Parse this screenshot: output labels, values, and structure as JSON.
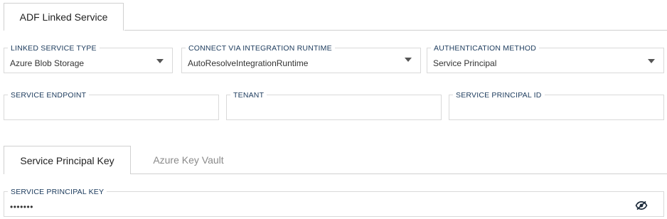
{
  "top_tabs": {
    "active_label": "ADF Linked Service"
  },
  "fields": {
    "linked_service_type": {
      "label": "LINKED SERVICE TYPE",
      "value": "Azure Blob Storage"
    },
    "integration_runtime": {
      "label": "CONNECT VIA INTEGRATION RUNTIME",
      "value": "AutoResolveIntegrationRuntime"
    },
    "authentication_method": {
      "label": "AUTHENTICATION METHOD",
      "value": "Service Principal"
    },
    "service_endpoint": {
      "label": "SERVICE ENDPOINT",
      "value": ""
    },
    "tenant": {
      "label": "TENANT",
      "value": ""
    },
    "service_principal_id": {
      "label": "SERVICE PRINCIPAL ID",
      "value": ""
    },
    "service_principal_key": {
      "label": "SERVICE PRINCIPAL KEY",
      "value": "•••••••"
    }
  },
  "key_tabs": {
    "active_label": "Service Principal Key",
    "inactive_label": "Azure Key Vault"
  },
  "icons": {
    "dropdown": "chevron-down-icon",
    "visibility": "eye-slash-icon"
  },
  "colors": {
    "label": "#1b3a5c",
    "border": "#d9d9d9"
  }
}
